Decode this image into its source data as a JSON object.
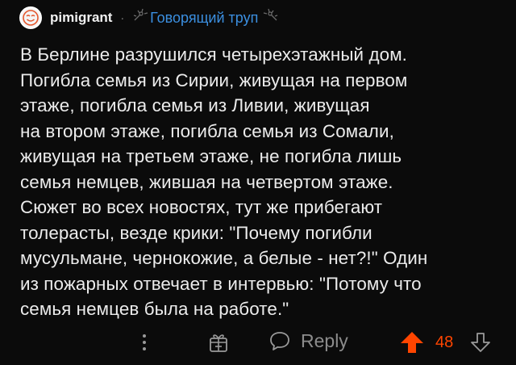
{
  "comment": {
    "author": "pimigrant",
    "separator": "·",
    "flair": "Говорящий труп",
    "text": "В Берлине разрушился четырехэтажный дом.\nПогибла семья из Сирии, живущая на первом\nэтаже, погибла семья из Ливии, живущая\nна втором этаже, погибла семья из Сомали,\nживущая на третьем этаже, не погибла лишь\nсемья немцев, жившая на четвертом этаже.\nСюжет во всех новостях, тут же прибегают\nтолерасты, везде крики: \"Почему погибли\nмусульмане, чернокожие, а белые - нет?!\" Один\nиз пожарных отвечает в интервью: \"Потому что\nсемья немцев была на работе.\""
  },
  "actions": {
    "reply_label": "Reply",
    "score": "48",
    "score_color": "#ff4500",
    "icons": [
      "more-options-icon",
      "award-icon",
      "reply-bubble-icon",
      "upvote-arrow-icon",
      "downvote-arrow-icon"
    ]
  },
  "colors": {
    "background": "#0b0b0b",
    "text": "#ececec",
    "flair": "#3b8fe0",
    "muted": "#8c8c8c"
  }
}
